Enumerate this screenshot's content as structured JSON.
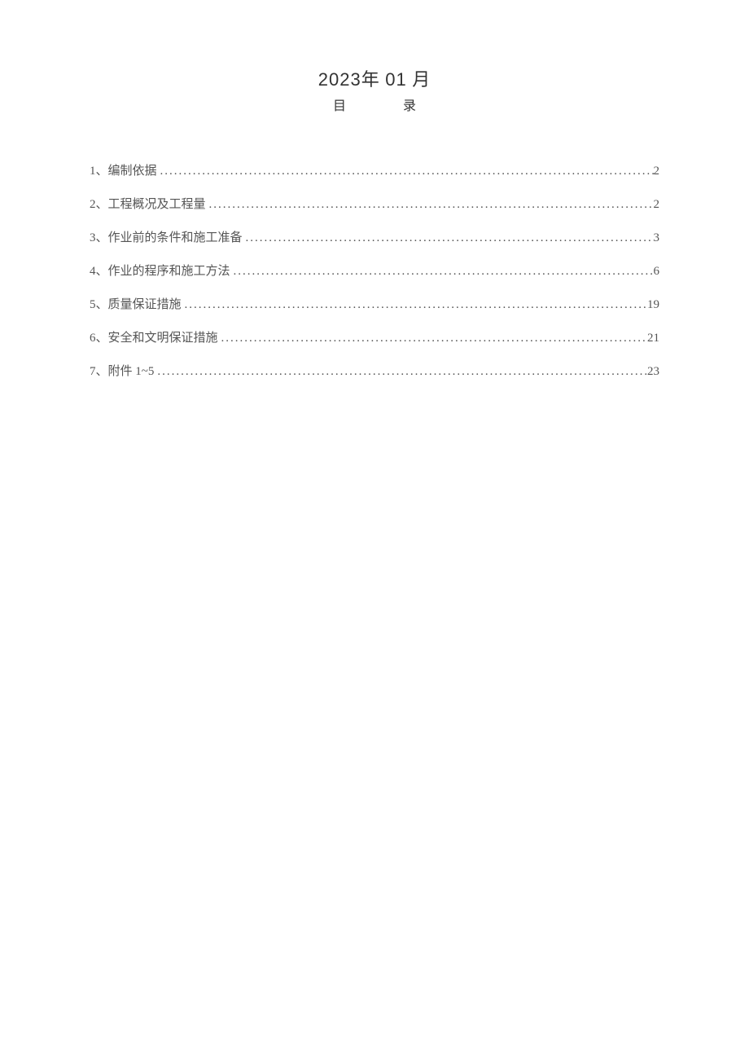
{
  "header": {
    "date_year_num": "2023",
    "date_year_char": "年",
    "date_month_num": "01",
    "date_month_char": "月",
    "toc_title_mu": "目",
    "toc_title_lu": "录"
  },
  "toc": {
    "items": [
      {
        "label": "1、编制依据",
        "page": "2"
      },
      {
        "label": "2、工程概况及工程量",
        "page": "2"
      },
      {
        "label": "3、作业前的条件和施工准备",
        "page": "3"
      },
      {
        "label": "4、作业的程序和施工方法",
        "page": "6"
      },
      {
        "label": "5、质量保证措施",
        "page": "19"
      },
      {
        "label": "6、安全和文明保证措施",
        "page": "21"
      },
      {
        "label": "7、附件 1~5",
        "page": "23"
      }
    ]
  }
}
